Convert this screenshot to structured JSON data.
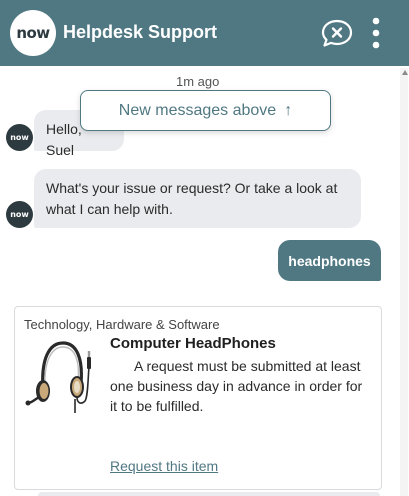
{
  "header": {
    "logo_text": "now",
    "title": "Helpdesk Support",
    "background_color": "#507883",
    "end_chat_icon": "end-chat-icon",
    "menu_icon": "more-vertical-icon"
  },
  "chat": {
    "timestamp": "1m ago",
    "new_messages_label": "New messages above",
    "new_messages_arrow": "↑",
    "messages": [
      {
        "sender": "bot",
        "avatar_text": "now",
        "text": "Hello, Suel"
      },
      {
        "sender": "bot",
        "avatar_text": "now",
        "text": "What's your issue or request? Or take a look at what I can help with."
      },
      {
        "sender": "user",
        "text": "headphones"
      }
    ],
    "card": {
      "category": "Technology, Hardware & Software",
      "title": "Computer HeadPhones",
      "description": "A request must be submitted at least one business day in advance in order for it to be fulfilled.",
      "link_label": "Request this item",
      "image_icon": "headset-icon"
    }
  },
  "colors": {
    "accent": "#507883",
    "bot_bubble": "#e9ebee",
    "avatar": "#2d3b40"
  }
}
